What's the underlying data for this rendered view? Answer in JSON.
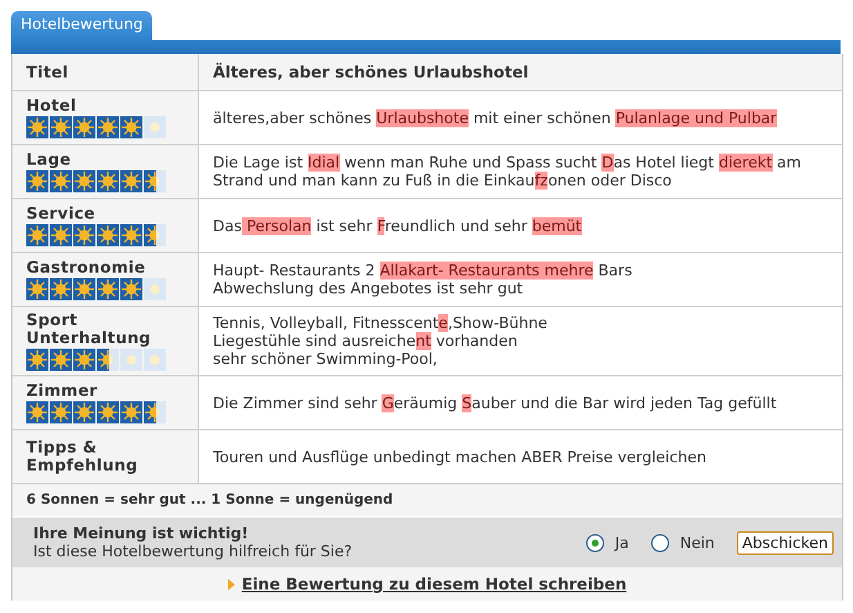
{
  "tab": {
    "label": "Hotelbewertung",
    "selected": true
  },
  "header": {
    "label": "Titel",
    "value": "Älteres, aber schönes Urlaubshotel"
  },
  "rows": [
    {
      "label": "Hotel",
      "stars": 5,
      "lines": [
        [
          {
            "text": "älteres,aber schönes ",
            "marked": false
          },
          {
            "text": "Urlaubshote",
            "marked": true
          },
          {
            "text": " mit einer schönen ",
            "marked": false
          },
          {
            "text": "Pulanlage und Pulbar",
            "marked": true
          }
        ]
      ]
    },
    {
      "label": "Lage",
      "stars": 5.5,
      "lines": [
        [
          {
            "text": "Die Lage ist ",
            "marked": false
          },
          {
            "text": "Idial",
            "marked": true
          },
          {
            "text": " wenn man Ruhe und Spass sucht ",
            "marked": false
          },
          {
            "text": "D",
            "marked": true
          },
          {
            "text": "as Hotel liegt ",
            "marked": false
          },
          {
            "text": "dierekt",
            "marked": true
          },
          {
            "text": " am",
            "marked": false
          }
        ],
        [
          {
            "text": "Strand und man kann zu Fuß in die Einkau",
            "marked": false
          },
          {
            "text": "fz",
            "marked": true
          },
          {
            "text": "onen oder Disco",
            "marked": false
          }
        ]
      ]
    },
    {
      "label": "Service",
      "stars": 5.5,
      "lines": [
        [
          {
            "text": "Das",
            "marked": false
          },
          {
            "text": " Persolan",
            "marked": true
          },
          {
            "text": " ist sehr ",
            "marked": false
          },
          {
            "text": "F",
            "marked": true
          },
          {
            "text": "reundlich und sehr ",
            "marked": false
          },
          {
            "text": "bemüt",
            "marked": true
          }
        ]
      ]
    },
    {
      "label": "Gastronomie",
      "stars": 5,
      "lines": [
        [
          {
            "text": "Haupt- Restaurants 2 ",
            "marked": false
          },
          {
            "text": "Allakart- Restaurants",
            "marked": true
          },
          {
            "text": " mehre",
            "marked": true
          },
          {
            "text": " Bars",
            "marked": false
          }
        ],
        [
          {
            "text": "Abwechslung des Angebotes ist sehr gut",
            "marked": false
          }
        ]
      ]
    },
    {
      "label": "Sport Unterhaltung",
      "stars": 3.5,
      "lines": [
        [
          {
            "text": "Tennis, Volleyball, Fitnesscent",
            "marked": false
          },
          {
            "text": "e",
            "marked": true
          },
          {
            "text": ",Show-Bühne",
            "marked": false
          }
        ],
        [
          {
            "text": "Liegestühle sind ausreiche",
            "marked": false
          },
          {
            "text": "nt",
            "marked": true
          },
          {
            "text": " vorhanden",
            "marked": false
          }
        ],
        [
          {
            "text": "sehr schöner Swimming-Pool,",
            "marked": false
          }
        ]
      ]
    },
    {
      "label": "Zimmer",
      "stars": 5.5,
      "lines": [
        [
          {
            "text": "Die Zimmer sind sehr ",
            "marked": false
          },
          {
            "text": "G",
            "marked": true
          },
          {
            "text": "eräumig ",
            "marked": false
          },
          {
            "text": "S",
            "marked": true
          },
          {
            "text": "auber und die Bar wird jeden Tag gefüllt",
            "marked": false
          }
        ]
      ]
    },
    {
      "label": "Tipps & Empfehlung",
      "lines": [
        [
          {
            "text": "Touren und Ausflüge unbedingt machen ABER Preise vergleichen",
            "marked": false
          }
        ]
      ]
    }
  ],
  "legend": "6 Sonnen = sehr gut ... 1 Sonne = ungenügend",
  "feedback": {
    "title": "Ihre Meinung ist wichtig!",
    "question": "Ist diese Hotelbewertung hilfreich für Sie?",
    "options": [
      {
        "label": "Ja",
        "selected": true
      },
      {
        "label": "Nein",
        "selected": false
      }
    ],
    "button": "Abschicken"
  },
  "link": "Eine Bewertung zu diesem Hotel schreiben"
}
